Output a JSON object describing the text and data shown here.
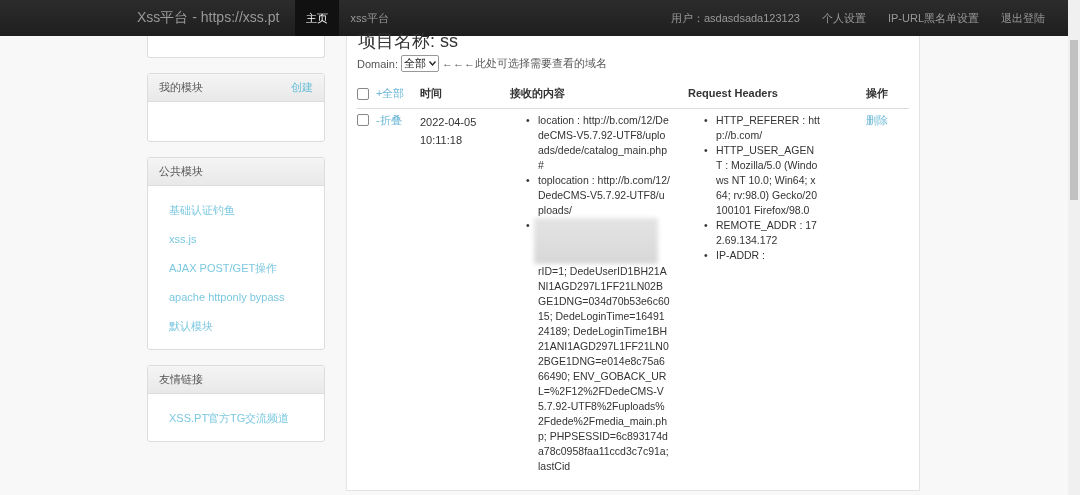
{
  "navbar": {
    "brand": "Xss平台 - https://xss.pt",
    "nav": [
      {
        "label": "主页",
        "selected": true
      },
      {
        "label": "xss平台",
        "selected": false
      }
    ],
    "links": [
      "用户：asdasdsada123123",
      "个人设置",
      "IP-URL黑名单设置",
      "退出登陆"
    ]
  },
  "sidebar": {
    "panels": [
      {
        "title": "我的模块",
        "action": "创建"
      },
      {
        "title": "公共模块",
        "items": [
          "基础认证钓鱼",
          "xss.js",
          "AJAX POST/GET操作",
          "apache httponly bypass",
          "默认模块"
        ]
      },
      {
        "title": "友情链接",
        "items": [
          "XSS.PT官方TG交流频道"
        ]
      }
    ]
  },
  "main": {
    "title": "项目名称: ss",
    "domain_label": "Domain:",
    "domain_value": "全部",
    "domain_hint": "←←←此处可选择需要查看的域名",
    "table": {
      "select_all": {
        "checked": false
      },
      "columns": [
        "+全部",
        "时间",
        "接收的内容",
        "Request Headers",
        "操作"
      ],
      "rows": [
        {
          "checked": false,
          "toggle": "-折叠",
          "time": "2022-04-05 10:11:18",
          "bullet": "•",
          "content": [
            {
              "text": "location : http://b.com/12/DedeCMS-V5.7.92-UTF8/uploads/dede/catalog_main.php#",
              "redacted_before": false
            },
            {
              "text": "toplocation : http://b.com/12/DedeCMS-V5.7.92-UTF8/uploads/",
              "redacted_before": false
            },
            {
              "text": "rID=1; DedeUserID1BH21ANI1AGD297L1FF21LN02BGE1DNG=034d70b53e6c6015; DedeLoginTime=1649124189; DedeLoginTime1BH21ANI1AGD297L1FF21LN02BGE1DNG=e014e8c75a666490; ENV_GOBACK_URL=%2F12%2FDedeCMS-V5.7.92-UTF8%2Fuploads%2Fdede%2Fmedia_main.php; PHPSESSID=6c893174da78c0958faa11ccd3c7c91a; lastCid",
              "redacted_before": true
            }
          ],
          "headers": [
            "HTTP_REFERER : http://b.com/",
            "HTTP_USER_AGENT : Mozilla/5.0 (Windows NT 10.0; Win64; x64; rv:98.0) Gecko/20100101 Firefox/98.0",
            "REMOTE_ADDR : 172.69.134.172",
            "IP-ADDR :"
          ],
          "action": "删除"
        }
      ]
    }
  }
}
